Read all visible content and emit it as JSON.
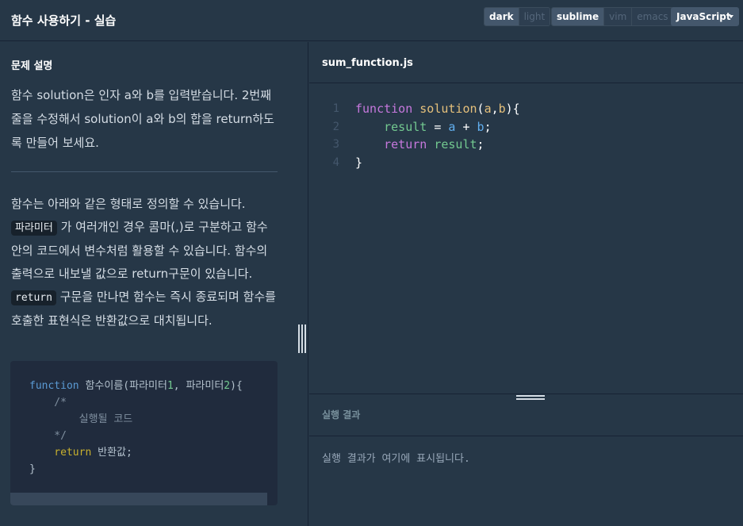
{
  "header": {
    "title": "함수 사용하기 - 실습",
    "theme_options": [
      "dark",
      "light"
    ],
    "theme_selected": "dark",
    "keymap_options": [
      "sublime",
      "vim",
      "emacs"
    ],
    "keymap_selected": "sublime",
    "language": "JavaScript"
  },
  "description": {
    "title": "문제 설명",
    "paragraph1": "함수 solution은 인자 a와 b를 입력받습니다. 2번째 줄을 수정해서 solution이 a와 b의 합을 return하도록 만들어 보세요.",
    "p2_line1": "함수는 아래와 같은 형태로 정의할 수 있습니다.",
    "chip_param": "파라미터",
    "p2_text2": " 가 여러개인 경우 콤마(,)로 구분하고 함수안의 코드에서 변수처럼 활용할 수 있습니다. 함수의 출력으로 내보낼 값으로 return구문이 있습니다.",
    "chip_return": "return",
    "p2_text3": " 구문을 만나면 함수는 즉시 종료되며 함수를 호출한 표현식은 반환값으로 대치됩니다.",
    "example_code": {
      "l1_kw": "function",
      "l1_name": " 함수이름(파라미터",
      "l1_n1": "1",
      "l1_mid": ", 파라미터",
      "l1_n2": "2",
      "l1_end": "){",
      "l2": "    /*",
      "l3": "        실행될 코드",
      "l4": "    */",
      "l5_kw": "    return",
      "l5_rest": " 반환값;",
      "l6": "}"
    }
  },
  "editor": {
    "file_name": "sum_function.js",
    "line_numbers": [
      "1",
      "2",
      "3",
      "4"
    ],
    "lines": {
      "l1_kw": "function",
      "l1_name": "solution",
      "l1_open": "(",
      "l1_a": "a",
      "l1_comma": ",",
      "l1_b": "b",
      "l1_close": "){",
      "l2_indent": "    ",
      "l2_var": "result",
      "l2_eq": " = ",
      "l2_a": "a",
      "l2_plus": " + ",
      "l2_b": "b",
      "l2_semi": ";",
      "l3_indent": "    ",
      "l3_kw": "return",
      "l3_var": " result",
      "l3_semi": ";",
      "l4": "}"
    }
  },
  "result": {
    "title": "실행 결과",
    "placeholder": "실행 결과가 여기에 표시됩니다."
  }
}
